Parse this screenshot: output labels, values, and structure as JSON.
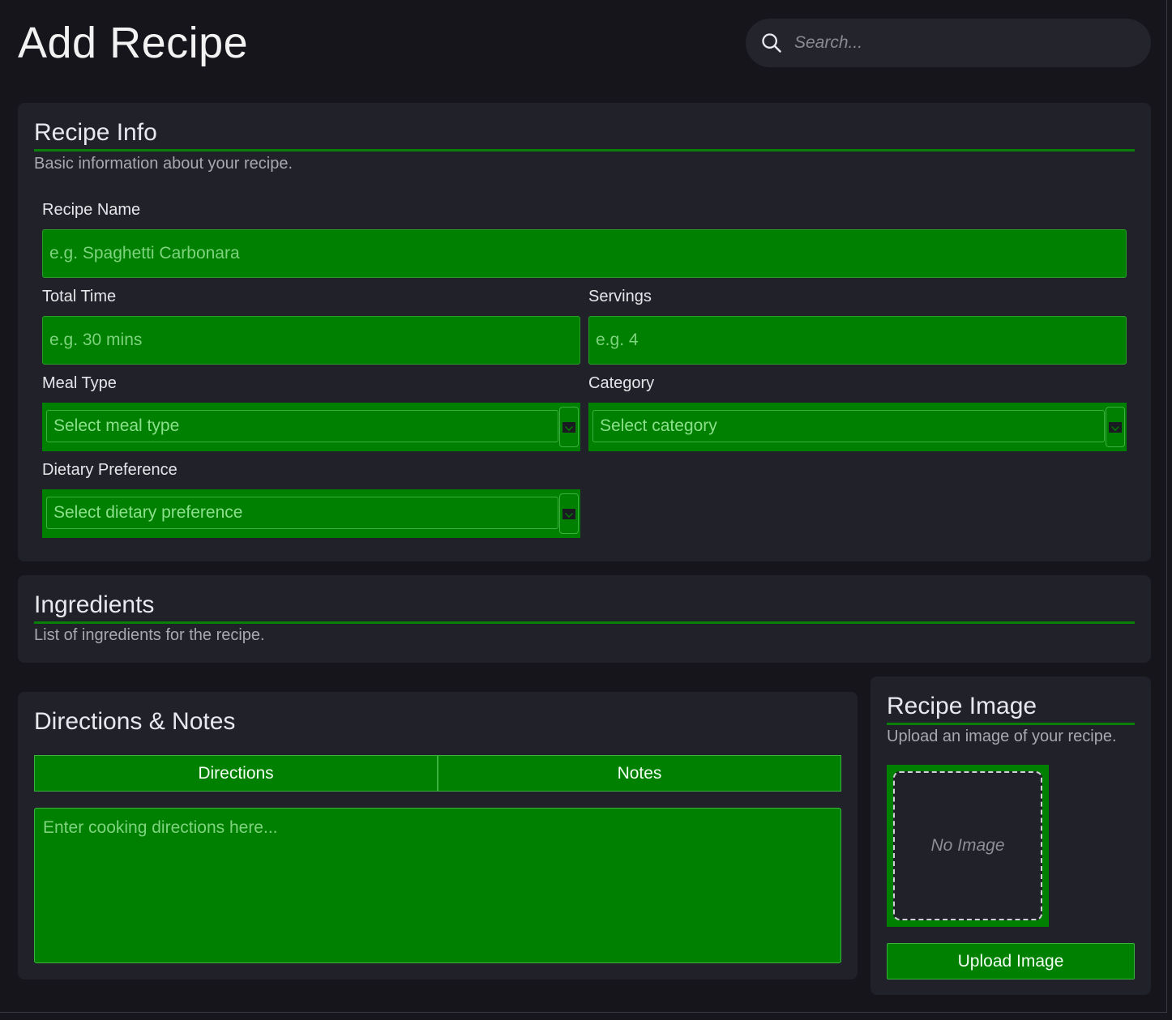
{
  "header": {
    "title": "Add Recipe",
    "search_placeholder": "Search..."
  },
  "recipe_info": {
    "title": "Recipe Info",
    "subtitle": "Basic information about your recipe.",
    "fields": {
      "name_label": "Recipe Name",
      "name_placeholder": "e.g. Spaghetti Carbonara",
      "time_label": "Total Time",
      "time_placeholder": "e.g. 30 mins",
      "servings_label": "Servings",
      "servings_placeholder": "e.g. 4",
      "meal_type_label": "Meal Type",
      "meal_type_value": "Select meal type",
      "category_label": "Category",
      "category_value": "Select category",
      "dietary_label": "Dietary Preference",
      "dietary_value": "Select dietary preference"
    }
  },
  "ingredients": {
    "title": "Ingredients",
    "subtitle": "List of ingredients for the recipe."
  },
  "directions": {
    "title": "Directions & Notes",
    "tabs": [
      "Directions",
      "Notes"
    ],
    "textarea_placeholder": "Enter cooking directions here..."
  },
  "recipe_image": {
    "title": "Recipe Image",
    "subtitle": "Upload an image of your recipe.",
    "empty_text": "No Image",
    "upload_label": "Upload Image"
  },
  "colors": {
    "accent": "#008000",
    "background": "#15151b",
    "card": "#212129"
  },
  "icons": {
    "search": "search-icon",
    "select": "chevron-down-icon"
  }
}
